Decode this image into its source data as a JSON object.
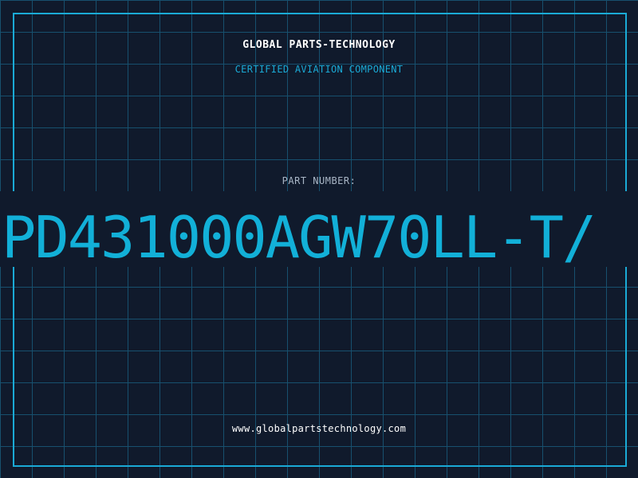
{
  "company_name": "GLOBAL PARTS-TECHNOLOGY",
  "tagline": "CERTIFIED AVIATION COMPONENT",
  "part_label": "PART NUMBER:",
  "part_number": "PD431000AGW70LL-T/",
  "website": "www.globalpartstechnology.com",
  "colors": {
    "background": "#101a2c",
    "grid": "#17506e",
    "accent": "#1aaad6",
    "text": "#ffffff",
    "label": "#a9b6c6"
  }
}
